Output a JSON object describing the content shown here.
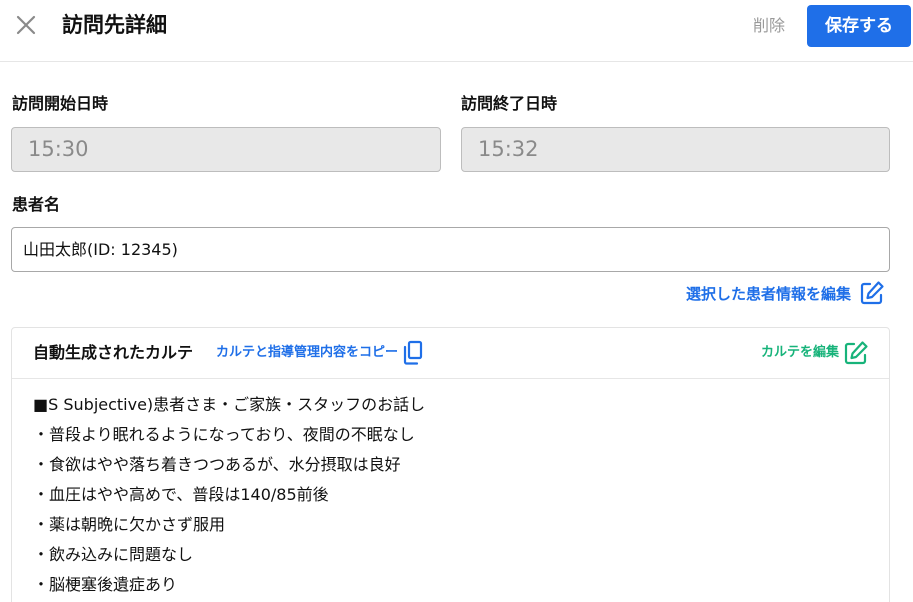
{
  "header": {
    "title": "訪問先詳細",
    "delete_label": "削除",
    "save_label": "保存する"
  },
  "form": {
    "start_label": "訪問開始日時",
    "start_value": "15:30",
    "end_label": "訪問終了日時",
    "end_value": "15:32",
    "patient_label": "患者名",
    "patient_value": "山田太郎(ID: 12345)",
    "edit_patient_label": "選択した患者情報を編集"
  },
  "karte": {
    "title": "自動生成されたカルテ",
    "copy_label": "カルテと指導管理内容をコピー",
    "edit_label": "カルテを編集",
    "lines": [
      "■S Subjective)患者さま・ご家族・スタッフのお話し",
      "・普段より眠れるようになっており、夜間の不眠なし",
      "・食欲はやや落ち着きつつあるが、水分摂取は良好",
      "・血圧はやや高めで、普段は140/85前後",
      "・薬は朝晩に欠かさず服用",
      "・飲み込みに問題なし",
      "・脳梗塞後遺症あり"
    ]
  },
  "colors": {
    "accent": "#1f6fe8",
    "edit_green": "#17b37a",
    "disabled_bg": "#e8e8e8"
  },
  "icons": [
    "close-icon",
    "edit-icon",
    "copy-icon"
  ]
}
